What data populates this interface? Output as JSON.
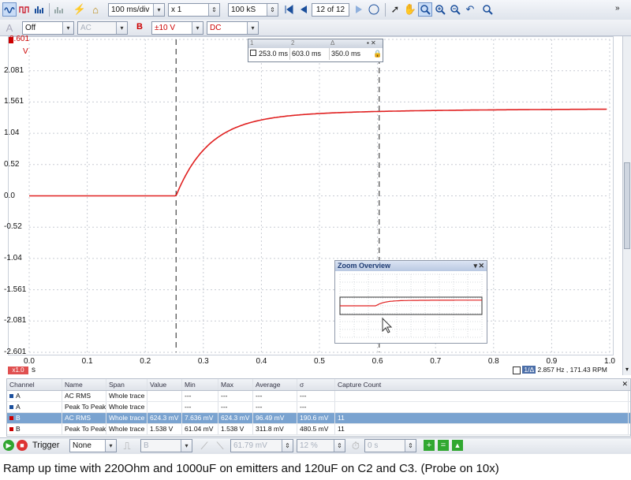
{
  "toolbar": {
    "timebase": "100 ms/div",
    "zoom": "x 1",
    "samples": "100 kS",
    "buffer_index": "12 of 12"
  },
  "channel_bar": {
    "channel_a_state": "Off",
    "channel_a_coupling": "AC",
    "channel_b_letter": "B",
    "channel_b_range": "±10 V",
    "channel_b_coupling": "DC"
  },
  "scope": {
    "y_unit": "V",
    "y_ticks": [
      "2.601",
      "2.081",
      "1.561",
      "1.04",
      "0.52",
      "0.0",
      "-0.52",
      "-1.04",
      "-1.561",
      "-2.081",
      "-2.601"
    ],
    "x_ticks": [
      "0.0",
      "0.1",
      "0.2",
      "0.3",
      "0.4",
      "0.5",
      "0.6",
      "0.7",
      "0.8",
      "0.9",
      "1.0"
    ],
    "x_unit": "s",
    "x_multiplier": "x1.0",
    "trace_color": "#e02020",
    "freq_readout": "2.857 Hz , 171.43 RPM",
    "freq_icon_text": "1/Δ"
  },
  "rulers": {
    "headers": [
      "1",
      "2",
      "Δ"
    ],
    "values": [
      "253.0 ms",
      "603.0 ms",
      "350.0 ms"
    ]
  },
  "zoom_overview": {
    "title": "Zoom Overview"
  },
  "measurements": {
    "headers": [
      "Channel",
      "Name",
      "Span",
      "Value",
      "Min",
      "Max",
      "Average",
      "σ",
      "Capture Count"
    ],
    "rows": [
      [
        "A",
        "AC RMS",
        "Whole trace",
        "",
        "---",
        "---",
        "---",
        "---",
        ""
      ],
      [
        "A",
        "Peak To Peak",
        "Whole trace",
        "",
        "---",
        "---",
        "---",
        "---",
        ""
      ],
      [
        "B",
        "AC RMS",
        "Whole trace",
        "624.3 mV",
        "7.636 mV",
        "624.3 mV",
        "96.49 mV",
        "190.6 mV",
        "11"
      ],
      [
        "B",
        "Peak To Peak",
        "Whole trace",
        "1.538 V",
        "61.04 mV",
        "1.538 V",
        "311.8 mV",
        "480.5 mV",
        "11"
      ]
    ]
  },
  "bottom_bar": {
    "trigger_label": "Trigger",
    "trigger_mode": "None",
    "trigger_source": "B",
    "threshold": "61.79 mV",
    "pretrigger": "12 %",
    "delay": "0 s"
  },
  "caption": "Ramp up time with 220Ohm and 1000uF on emitters and 120uF on C2 and C3. (Probe on 10x)"
}
